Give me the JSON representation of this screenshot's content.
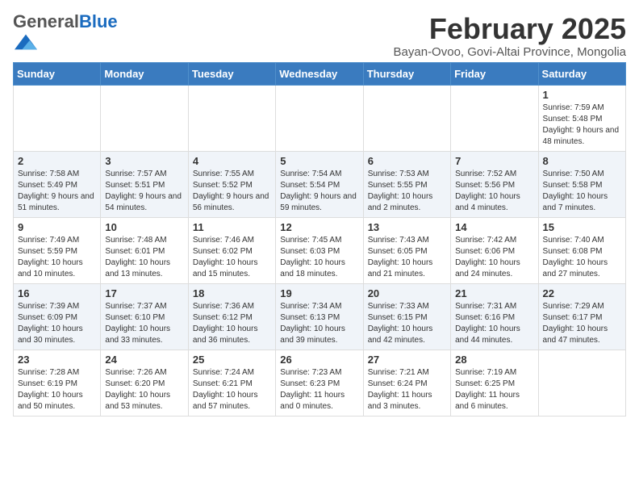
{
  "header": {
    "logo_general": "General",
    "logo_blue": "Blue",
    "month_title": "February 2025",
    "subtitle": "Bayan-Ovoo, Govi-Altai Province, Mongolia"
  },
  "days_of_week": [
    "Sunday",
    "Monday",
    "Tuesday",
    "Wednesday",
    "Thursday",
    "Friday",
    "Saturday"
  ],
  "weeks": [
    [
      {
        "day": "",
        "info": ""
      },
      {
        "day": "",
        "info": ""
      },
      {
        "day": "",
        "info": ""
      },
      {
        "day": "",
        "info": ""
      },
      {
        "day": "",
        "info": ""
      },
      {
        "day": "",
        "info": ""
      },
      {
        "day": "1",
        "info": "Sunrise: 7:59 AM\nSunset: 5:48 PM\nDaylight: 9 hours and 48 minutes."
      }
    ],
    [
      {
        "day": "2",
        "info": "Sunrise: 7:58 AM\nSunset: 5:49 PM\nDaylight: 9 hours and 51 minutes."
      },
      {
        "day": "3",
        "info": "Sunrise: 7:57 AM\nSunset: 5:51 PM\nDaylight: 9 hours and 54 minutes."
      },
      {
        "day": "4",
        "info": "Sunrise: 7:55 AM\nSunset: 5:52 PM\nDaylight: 9 hours and 56 minutes."
      },
      {
        "day": "5",
        "info": "Sunrise: 7:54 AM\nSunset: 5:54 PM\nDaylight: 9 hours and 59 minutes."
      },
      {
        "day": "6",
        "info": "Sunrise: 7:53 AM\nSunset: 5:55 PM\nDaylight: 10 hours and 2 minutes."
      },
      {
        "day": "7",
        "info": "Sunrise: 7:52 AM\nSunset: 5:56 PM\nDaylight: 10 hours and 4 minutes."
      },
      {
        "day": "8",
        "info": "Sunrise: 7:50 AM\nSunset: 5:58 PM\nDaylight: 10 hours and 7 minutes."
      }
    ],
    [
      {
        "day": "9",
        "info": "Sunrise: 7:49 AM\nSunset: 5:59 PM\nDaylight: 10 hours and 10 minutes."
      },
      {
        "day": "10",
        "info": "Sunrise: 7:48 AM\nSunset: 6:01 PM\nDaylight: 10 hours and 13 minutes."
      },
      {
        "day": "11",
        "info": "Sunrise: 7:46 AM\nSunset: 6:02 PM\nDaylight: 10 hours and 15 minutes."
      },
      {
        "day": "12",
        "info": "Sunrise: 7:45 AM\nSunset: 6:03 PM\nDaylight: 10 hours and 18 minutes."
      },
      {
        "day": "13",
        "info": "Sunrise: 7:43 AM\nSunset: 6:05 PM\nDaylight: 10 hours and 21 minutes."
      },
      {
        "day": "14",
        "info": "Sunrise: 7:42 AM\nSunset: 6:06 PM\nDaylight: 10 hours and 24 minutes."
      },
      {
        "day": "15",
        "info": "Sunrise: 7:40 AM\nSunset: 6:08 PM\nDaylight: 10 hours and 27 minutes."
      }
    ],
    [
      {
        "day": "16",
        "info": "Sunrise: 7:39 AM\nSunset: 6:09 PM\nDaylight: 10 hours and 30 minutes."
      },
      {
        "day": "17",
        "info": "Sunrise: 7:37 AM\nSunset: 6:10 PM\nDaylight: 10 hours and 33 minutes."
      },
      {
        "day": "18",
        "info": "Sunrise: 7:36 AM\nSunset: 6:12 PM\nDaylight: 10 hours and 36 minutes."
      },
      {
        "day": "19",
        "info": "Sunrise: 7:34 AM\nSunset: 6:13 PM\nDaylight: 10 hours and 39 minutes."
      },
      {
        "day": "20",
        "info": "Sunrise: 7:33 AM\nSunset: 6:15 PM\nDaylight: 10 hours and 42 minutes."
      },
      {
        "day": "21",
        "info": "Sunrise: 7:31 AM\nSunset: 6:16 PM\nDaylight: 10 hours and 44 minutes."
      },
      {
        "day": "22",
        "info": "Sunrise: 7:29 AM\nSunset: 6:17 PM\nDaylight: 10 hours and 47 minutes."
      }
    ],
    [
      {
        "day": "23",
        "info": "Sunrise: 7:28 AM\nSunset: 6:19 PM\nDaylight: 10 hours and 50 minutes."
      },
      {
        "day": "24",
        "info": "Sunrise: 7:26 AM\nSunset: 6:20 PM\nDaylight: 10 hours and 53 minutes."
      },
      {
        "day": "25",
        "info": "Sunrise: 7:24 AM\nSunset: 6:21 PM\nDaylight: 10 hours and 57 minutes."
      },
      {
        "day": "26",
        "info": "Sunrise: 7:23 AM\nSunset: 6:23 PM\nDaylight: 11 hours and 0 minutes."
      },
      {
        "day": "27",
        "info": "Sunrise: 7:21 AM\nSunset: 6:24 PM\nDaylight: 11 hours and 3 minutes."
      },
      {
        "day": "28",
        "info": "Sunrise: 7:19 AM\nSunset: 6:25 PM\nDaylight: 11 hours and 6 minutes."
      },
      {
        "day": "",
        "info": ""
      }
    ]
  ]
}
